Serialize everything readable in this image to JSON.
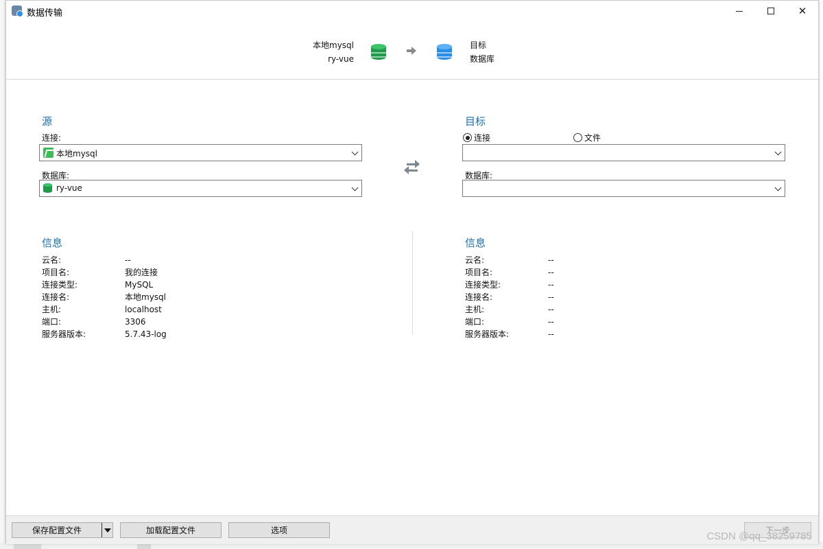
{
  "window": {
    "title": "数据传输"
  },
  "header": {
    "source_line1": "本地mysql",
    "source_line2": "ry-vue",
    "target_line1": "目标",
    "target_line2": "数据库"
  },
  "source": {
    "section_title": "源",
    "connection_label": "连接:",
    "connection_value": "本地mysql",
    "database_label": "数据库:",
    "database_value": "ry-vue"
  },
  "target": {
    "section_title": "目标",
    "radio_connection": "连接",
    "radio_file": "文件",
    "radio_selected": "连接",
    "connection_value": "",
    "database_label": "数据库:",
    "database_value": ""
  },
  "source_info": {
    "section_title": "信息",
    "rows": [
      {
        "key": "云名:",
        "value": "--"
      },
      {
        "key": "项目名:",
        "value": "我的连接"
      },
      {
        "key": "连接类型:",
        "value": "MySQL"
      },
      {
        "key": "连接名:",
        "value": "本地mysql"
      },
      {
        "key": "主机:",
        "value": "localhost"
      },
      {
        "key": "端口:",
        "value": "3306"
      },
      {
        "key": "服务器版本:",
        "value": "5.7.43-log"
      }
    ]
  },
  "target_info": {
    "section_title": "信息",
    "rows": [
      {
        "key": "云名:",
        "value": "--"
      },
      {
        "key": "项目名:",
        "value": "--"
      },
      {
        "key": "连接类型:",
        "value": "--"
      },
      {
        "key": "连接名:",
        "value": "--"
      },
      {
        "key": "主机:",
        "value": "--"
      },
      {
        "key": "端口:",
        "value": "--"
      },
      {
        "key": "服务器版本:",
        "value": "--"
      }
    ]
  },
  "footer": {
    "save_profile": "保存配置文件",
    "load_profile": "加载配置文件",
    "options": "选项",
    "next": "下一步"
  },
  "watermark": "CSDN @qq_38259785",
  "colors": {
    "accent": "#1b6fb2",
    "source_db": "#1f9a4a",
    "target_db": "#2b8ee6"
  }
}
